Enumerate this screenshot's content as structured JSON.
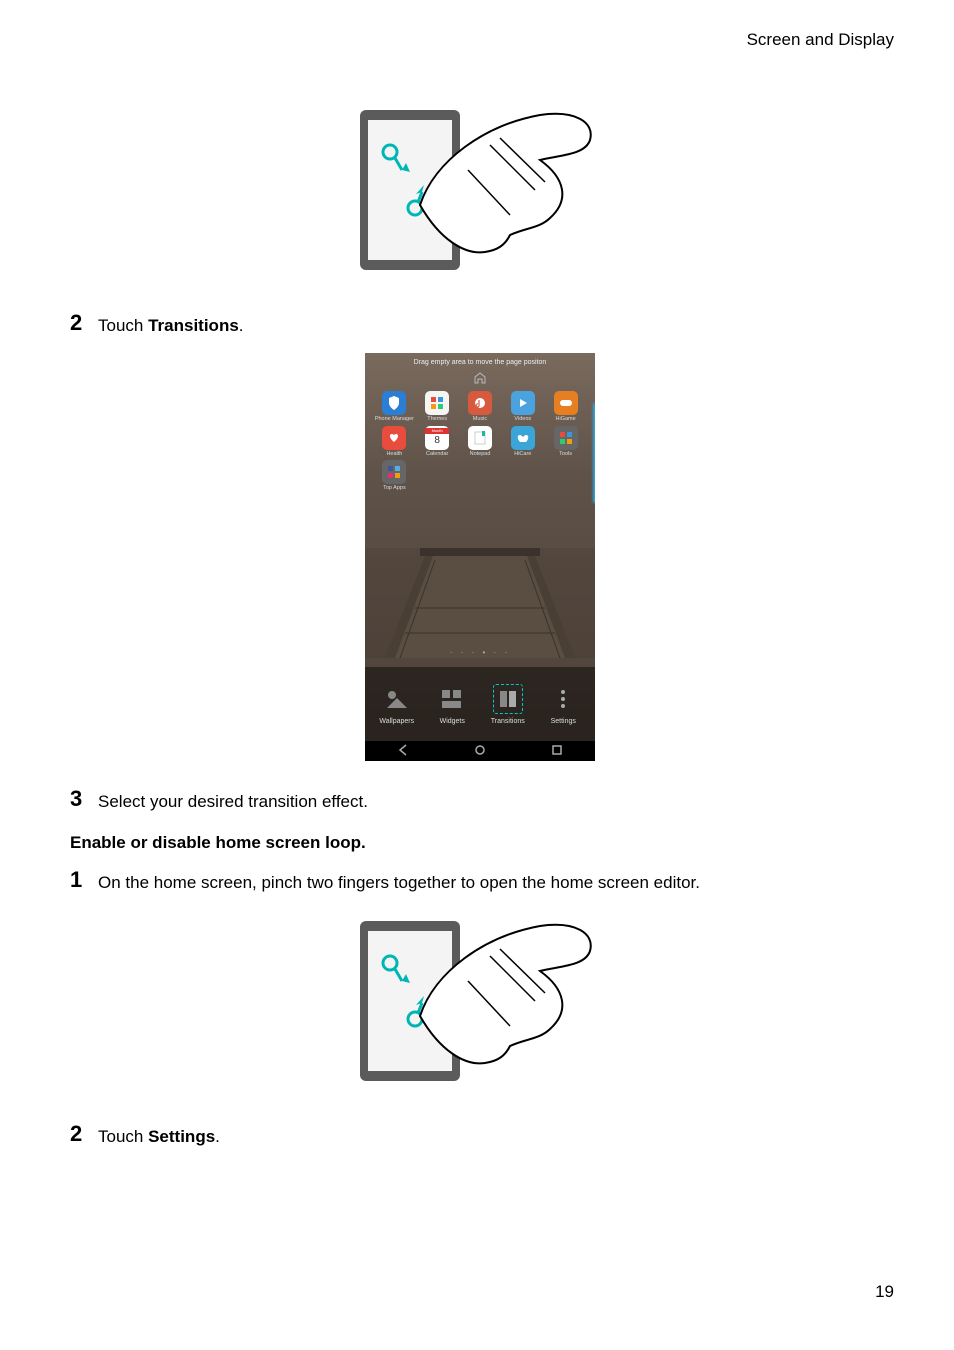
{
  "header": "Screen and Display",
  "page_number": "19",
  "section1": {
    "step2_num": "2",
    "step2_a": "Touch ",
    "step2_b": "Transitions",
    "step2_c": ".",
    "step3_num": "3",
    "step3_text": "Select your desired transition effect."
  },
  "section2": {
    "heading": "Enable or disable home screen loop.",
    "step1_num": "1",
    "step1_text": "On the home screen, pinch two fingers together to open the home screen editor.",
    "step2_num": "2",
    "step2_a": "Touch ",
    "step2_b": "Settings",
    "step2_c": "."
  },
  "phone": {
    "hint": "Drag empty area to move the page positon",
    "apps": {
      "r1": [
        "Phone Manager",
        "Themes",
        "Music",
        "Videos",
        "HiGame"
      ],
      "r2": [
        "Health",
        "Calendar",
        "Notepad",
        "HiCare",
        "Tools"
      ],
      "r3": [
        "Top Apps"
      ]
    },
    "calendar_day": "8",
    "bottom": [
      "Wallpapers",
      "Widgets",
      "Transitions",
      "Settings"
    ]
  }
}
